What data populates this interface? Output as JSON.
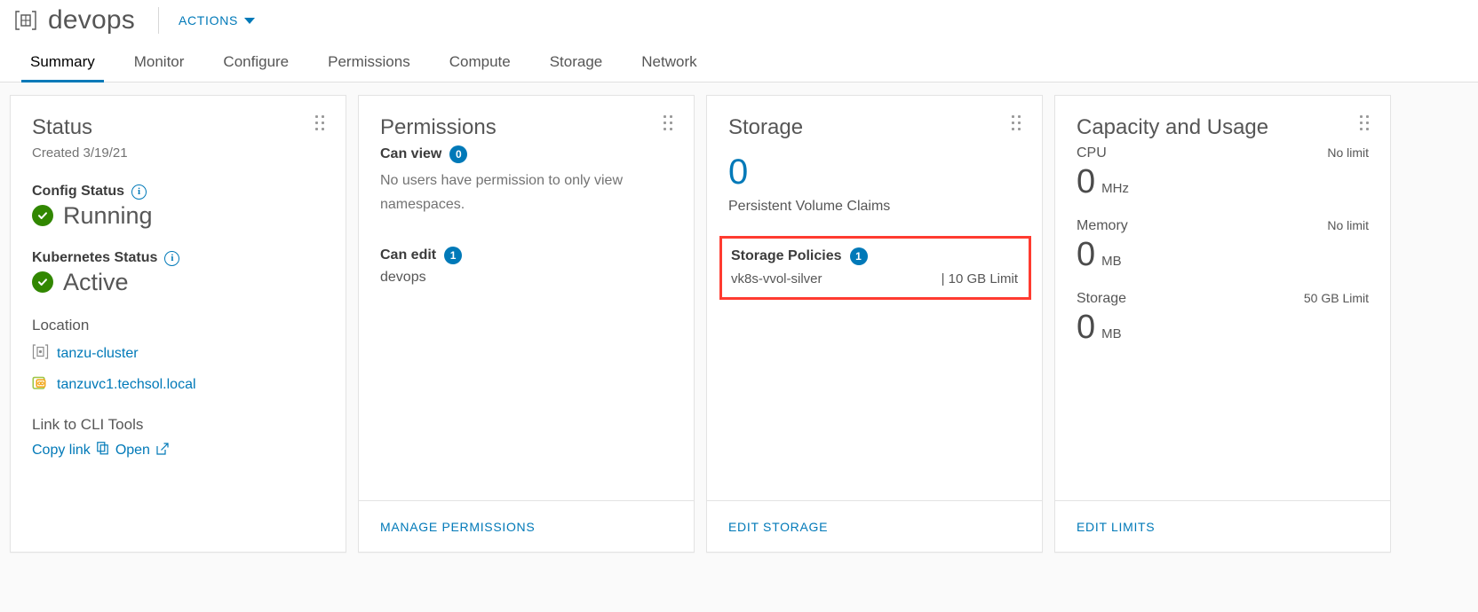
{
  "header": {
    "object_icon": "namespace-icon",
    "title": "devops",
    "actions_label": "ACTIONS"
  },
  "tabs": [
    {
      "label": "Summary",
      "active": true
    },
    {
      "label": "Monitor",
      "active": false
    },
    {
      "label": "Configure",
      "active": false
    },
    {
      "label": "Permissions",
      "active": false
    },
    {
      "label": "Compute",
      "active": false
    },
    {
      "label": "Storage",
      "active": false
    },
    {
      "label": "Network",
      "active": false
    }
  ],
  "status_card": {
    "title": "Status",
    "created": "Created 3/19/21",
    "config_status_label": "Config Status",
    "config_status_value": "Running",
    "kubernetes_status_label": "Kubernetes Status",
    "kubernetes_status_value": "Active",
    "location_label": "Location",
    "location_cluster": "tanzu-cluster",
    "location_vcenter": "tanzuvc1.techsol.local",
    "cli_label": "Link to CLI Tools",
    "cli_copy": "Copy link",
    "cli_open": "Open"
  },
  "permissions_card": {
    "title": "Permissions",
    "can_view_label": "Can view",
    "can_view_count": "0",
    "can_view_note": "No users have permission to only view namespaces.",
    "can_edit_label": "Can edit",
    "can_edit_count": "1",
    "can_edit_user": "devops",
    "footer_link": "MANAGE PERMISSIONS"
  },
  "storage_card": {
    "title": "Storage",
    "pvc_count": "0",
    "pvc_label": "Persistent Volume Claims",
    "policies_label": "Storage Policies",
    "policies_count": "1",
    "policy_name": "vk8s-vvol-silver",
    "policy_limit": "| 10 GB Limit",
    "footer_link": "EDIT STORAGE",
    "highlight_color": "#ff3b30"
  },
  "capacity_card": {
    "title": "Capacity and Usage",
    "metrics": [
      {
        "name": "CPU",
        "limit": "No limit",
        "value": "0",
        "unit": "MHz"
      },
      {
        "name": "Memory",
        "limit": "No limit",
        "value": "0",
        "unit": "MB"
      },
      {
        "name": "Storage",
        "limit": "50 GB Limit",
        "value": "0",
        "unit": "MB"
      }
    ],
    "footer_link": "EDIT LIMITS"
  },
  "colors": {
    "accent": "#0079b8",
    "success": "#318700",
    "highlight": "#ff3b30",
    "text": "#565656"
  }
}
